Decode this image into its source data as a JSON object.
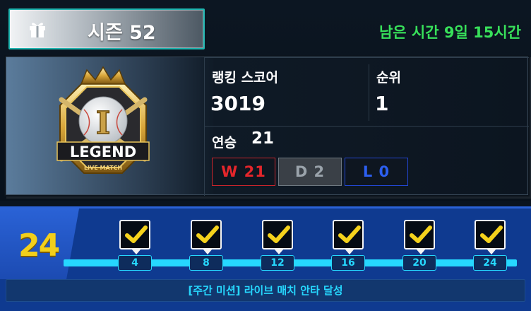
{
  "season": {
    "label": "시즌 52",
    "icon": "gift-icon"
  },
  "time_left": "남은 시간 9일 15시간",
  "emblem": {
    "tier": "LEGEND",
    "subtitle": "LIVE MATCH",
    "letter": "I"
  },
  "ranking": {
    "score_label": "랭킹 스코어",
    "score": "3019",
    "rank_label": "순위",
    "rank": "1"
  },
  "streak": {
    "label": "연승",
    "value": "21"
  },
  "record": {
    "wins": "W 21",
    "draws": "D 2",
    "losses": "L 0"
  },
  "mission": {
    "count": "24",
    "milestones": [
      "4",
      "8",
      "12",
      "16",
      "20",
      "24"
    ],
    "completed": [
      true,
      true,
      true,
      true,
      true,
      true
    ],
    "description": "[주간 미션] 라이브 매치 안타 달성"
  },
  "colors": {
    "time_green": "#38e05a",
    "accent_cyan": "#26d8ff",
    "count_yellow": "#f2cf1b",
    "win_red": "#e4262b",
    "loss_blue": "#2c5ff0"
  }
}
